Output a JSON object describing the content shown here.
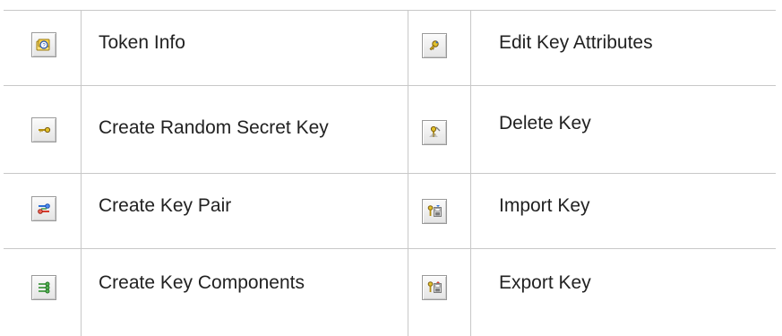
{
  "toolbar_reference": {
    "rows": [
      {
        "left": {
          "label": "Token Info",
          "icon": "token-info-icon"
        },
        "right": {
          "label": "Edit Key Attributes",
          "icon": "edit-key-attributes-icon"
        }
      },
      {
        "left": {
          "label": "Create Random Secret Key",
          "icon": "create-random-secret-key-icon"
        },
        "right": {
          "label": "Delete Key",
          "icon": "delete-key-icon"
        }
      },
      {
        "left": {
          "label": "Create Key Pair",
          "icon": "create-key-pair-icon"
        },
        "right": {
          "label": "Import Key",
          "icon": "import-key-icon"
        }
      },
      {
        "left": {
          "label": "Create Key Components",
          "icon": "create-key-components-icon"
        },
        "right": {
          "label": "Export Key",
          "icon": "export-key-icon"
        }
      }
    ]
  },
  "colors": {
    "grid_line": "#c8c8c8",
    "text": "#222222",
    "key_gold": "#d6b21a",
    "key_red": "#d63a2c",
    "key_blue": "#2b6fd6",
    "key_green": "#3b9a3b",
    "disk_gray": "#7d7d7d"
  }
}
